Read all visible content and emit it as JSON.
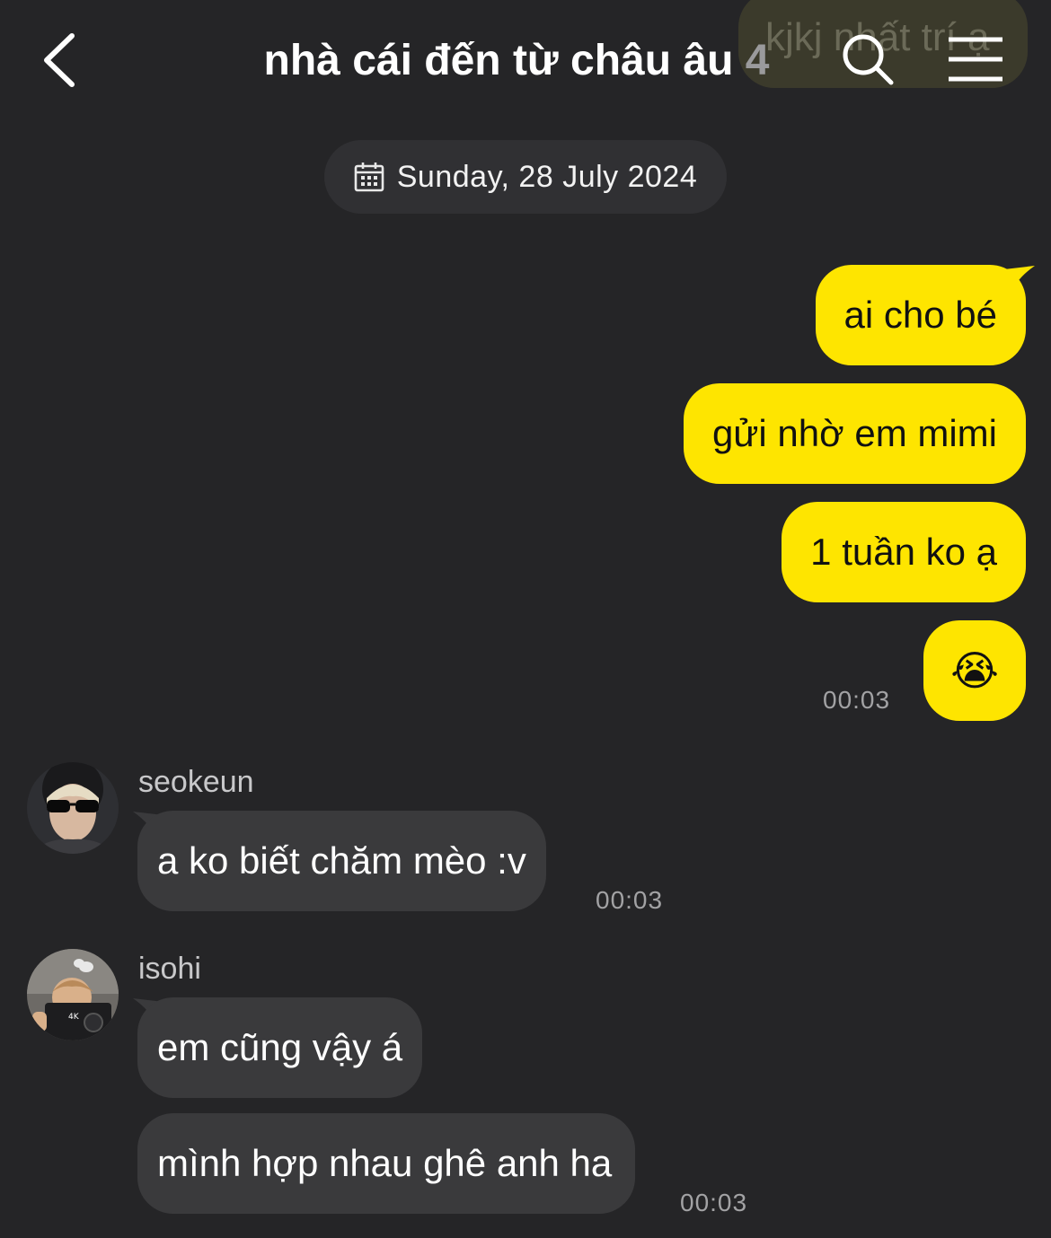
{
  "header": {
    "ghost_text": "kjkj nhất trí ạ",
    "title": "nhà cái đến từ châu âu",
    "member_count": "4",
    "icons": {
      "back": "chevron-left-icon",
      "search": "search-icon",
      "menu": "hamburger-menu-icon"
    }
  },
  "date_divider": {
    "label": "Sunday, 28 July 2024",
    "icon": "calendar-icon"
  },
  "outgoing": {
    "messages": [
      "ai cho bé",
      "gửi nhờ em mimi",
      "1 tuần ko ạ",
      "😭"
    ],
    "time": "00:03"
  },
  "incoming": [
    {
      "sender": "seokeun",
      "messages": [
        "a ko biết chăm mèo :v"
      ],
      "time": "00:03"
    },
    {
      "sender": "isohi",
      "messages": [
        "em cũng vậy á",
        "mình hợp nhau ghê anh ha"
      ],
      "time": "00:03"
    }
  ],
  "colors": {
    "background": "#252527",
    "outgoing_bubble": "#fee500",
    "incoming_bubble": "#3a3a3c",
    "date_pill": "#303033"
  }
}
